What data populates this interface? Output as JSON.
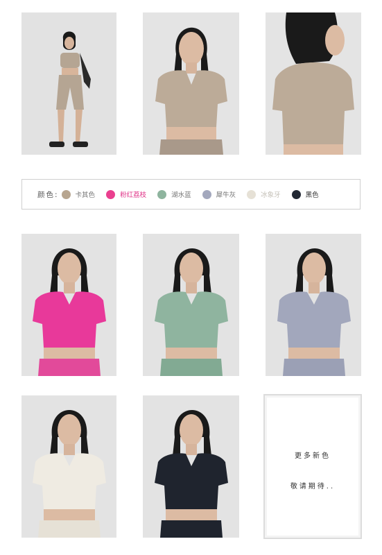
{
  "colors_label": "颜色:",
  "swatches": [
    {
      "name": "卡其色",
      "hex": "#b7a58f",
      "text_color": "#777777"
    },
    {
      "name": "粉红荔枝",
      "hex": "#ea3f8f",
      "text_color": "#e0378a"
    },
    {
      "name": "湖水蓝",
      "hex": "#8eb49e",
      "text_color": "#777777"
    },
    {
      "name": "犀牛灰",
      "hex": "#a3a8bd",
      "text_color": "#777777"
    },
    {
      "name": "冰象牙",
      "hex": "#e6e1d6",
      "text_color": "#c5c1b8"
    },
    {
      "name": "黑色",
      "hex": "#222833",
      "text_color": "#333333"
    }
  ],
  "more_colors": {
    "line1": "更多新色",
    "line2": "敬请期待.."
  }
}
